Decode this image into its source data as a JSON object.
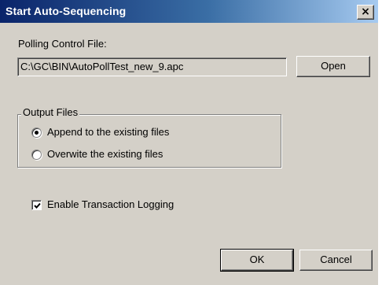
{
  "window": {
    "title": "Start Auto-Sequencing",
    "close_glyph": "×"
  },
  "polling": {
    "label": "Polling Control File:",
    "path_value": "C:\\GC\\BIN\\AutoPollTest_new_9.apc",
    "open_button": "Open"
  },
  "output_files": {
    "caption": "Output Files",
    "options": [
      {
        "label": "Append to the existing files",
        "checked": true
      },
      {
        "label": "Overwite the existing files",
        "checked": false
      }
    ]
  },
  "logging": {
    "label": "Enable Transaction Logging",
    "checked": true
  },
  "buttons": {
    "ok": "OK",
    "cancel": "Cancel"
  },
  "icons": {
    "close": "close-icon",
    "radio": "radio-button",
    "check": "checkmark-icon"
  },
  "colors": {
    "title_bar_start": "#0a246a",
    "title_bar_end": "#a6caf0",
    "dialog_face": "#d4d0c8"
  }
}
